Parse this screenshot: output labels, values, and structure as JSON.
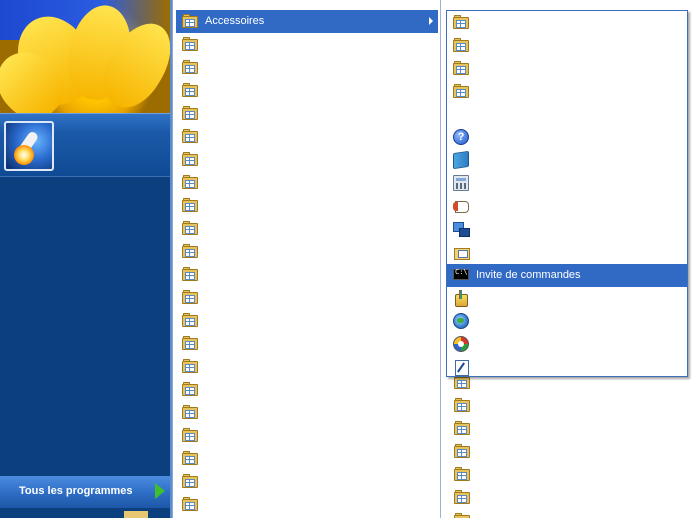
{
  "left_pane": {
    "all_programs_label": "Tous les programmes"
  },
  "programs_menu": {
    "items": [
      {
        "label": "Accessoires",
        "icon": "program-group-icon",
        "selected": true,
        "has_submenu": true
      },
      {
        "label": "",
        "icon": "program-group-icon"
      },
      {
        "label": "",
        "icon": "program-group-icon"
      },
      {
        "label": "",
        "icon": "program-group-icon"
      },
      {
        "label": "",
        "icon": "program-group-icon"
      },
      {
        "label": "",
        "icon": "program-group-icon"
      },
      {
        "label": "",
        "icon": "program-group-icon"
      },
      {
        "label": "",
        "icon": "program-group-icon"
      },
      {
        "label": "",
        "icon": "program-group-icon"
      },
      {
        "label": "",
        "icon": "program-group-icon"
      },
      {
        "label": "",
        "icon": "program-group-icon"
      },
      {
        "label": "",
        "icon": "program-group-icon"
      },
      {
        "label": "",
        "icon": "program-group-icon"
      },
      {
        "label": "",
        "icon": "program-group-icon"
      },
      {
        "label": "",
        "icon": "program-group-icon"
      },
      {
        "label": "",
        "icon": "program-group-icon"
      },
      {
        "label": "",
        "icon": "program-group-icon"
      },
      {
        "label": "",
        "icon": "program-group-icon"
      },
      {
        "label": "",
        "icon": "program-group-icon"
      },
      {
        "label": "",
        "icon": "program-group-icon"
      },
      {
        "label": "",
        "icon": "program-group-icon"
      },
      {
        "label": "",
        "icon": "program-group-icon"
      }
    ]
  },
  "accessories_menu": {
    "items": [
      {
        "label": "",
        "icon": "program-group-icon"
      },
      {
        "label": "",
        "icon": "program-group-icon"
      },
      {
        "label": "",
        "icon": "program-group-icon"
      },
      {
        "label": "",
        "icon": "program-group-icon"
      },
      {
        "label": "",
        "icon": "scanner-camera-icon"
      },
      {
        "label": "",
        "icon": "help-icon"
      },
      {
        "label": "",
        "icon": "address-book-icon"
      },
      {
        "label": "",
        "icon": "calculator-icon"
      },
      {
        "label": "",
        "icon": "wordpad-icon"
      },
      {
        "label": "",
        "icon": "network-connection-icon"
      },
      {
        "label": "",
        "icon": "windows-explorer-icon"
      },
      {
        "label": "Invite de commandes",
        "icon": "command-prompt-icon",
        "selected": true
      },
      {
        "label": "",
        "icon": "paint-icon"
      },
      {
        "label": "",
        "icon": "globe-icon"
      },
      {
        "label": "",
        "icon": "wizard-icon"
      },
      {
        "label": "",
        "icon": "notepad-icon"
      }
    ]
  },
  "background_column": {
    "item_count": 7,
    "icon": "program-group-icon"
  },
  "colors": {
    "selection": "#316ac5",
    "left_pane": "#0b3f7d",
    "all_programs_arrow": "#3fbf2f"
  }
}
